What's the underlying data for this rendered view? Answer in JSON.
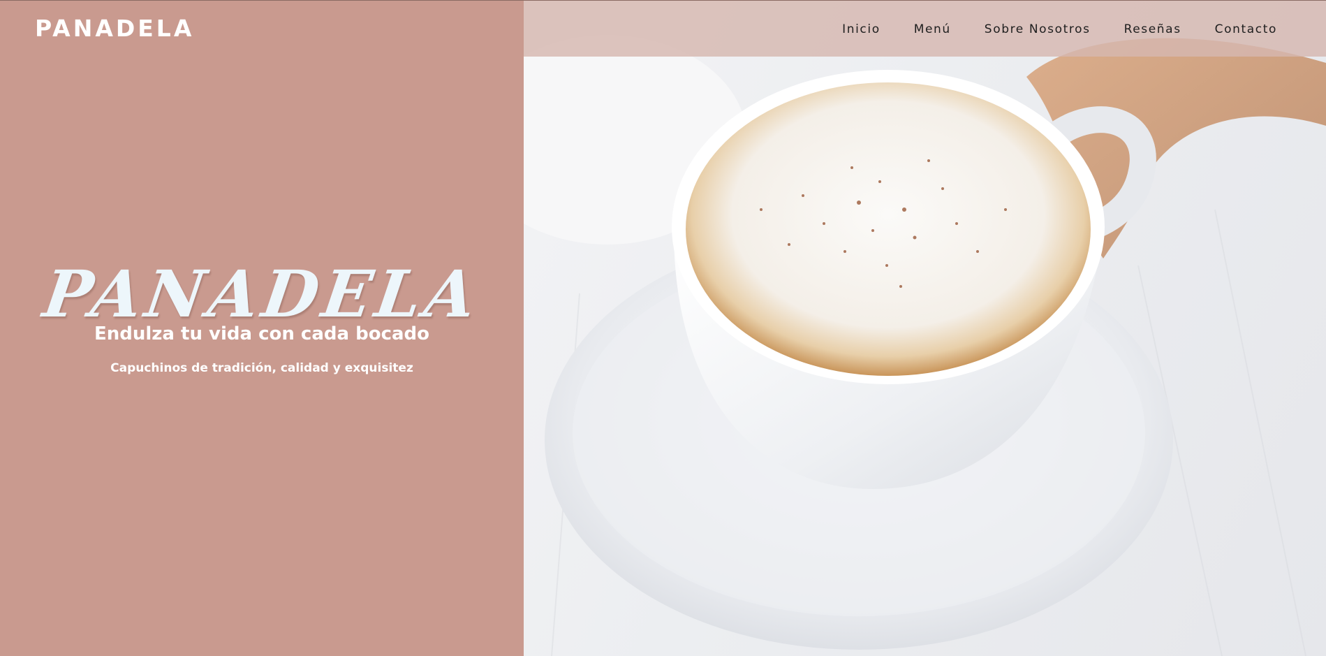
{
  "header": {
    "logo": "PANADELA",
    "nav": [
      "Inicio",
      "Menú",
      "Sobre Nosotros",
      "Reseñas",
      "Contacto"
    ]
  },
  "hero": {
    "title": "PANADELA",
    "tagline": "Endulza tu vida con cada bocado",
    "subtitle": "Capuchinos de tradición, calidad y exquisitez",
    "image": "cappuccino-cup-on-saucer"
  },
  "colors": {
    "panel": "#c99a8f",
    "header_bar": "#d6b7b0",
    "text_light": "#ffffff",
    "title": "#edf6fb",
    "nav_text": "#1e1e1e"
  }
}
